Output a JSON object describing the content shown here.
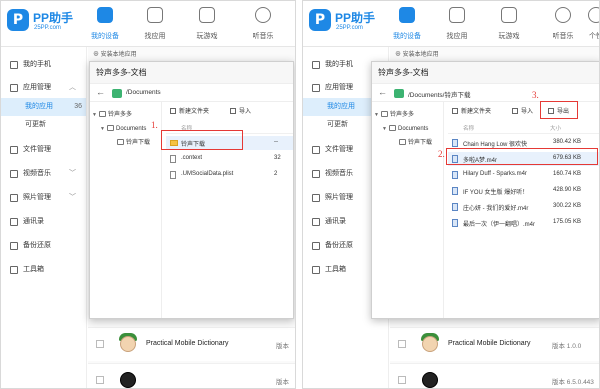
{
  "header": {
    "logo_letter": "P",
    "brand": "PP助手",
    "brand_url": "25PP.com",
    "nav": [
      {
        "label": "我的设备",
        "icon": "phone-icon",
        "active": true
      },
      {
        "label": "找应用",
        "icon": "bag-icon",
        "active": false
      },
      {
        "label": "玩游戏",
        "icon": "gamepad-icon",
        "active": false
      },
      {
        "label": "听音乐",
        "icon": "headphones-icon",
        "active": false
      }
    ],
    "nav_right_partial": "个性",
    "toolbar_partial": "安装本地应用"
  },
  "sidebar": {
    "items": [
      {
        "label": "我的手机",
        "icon": "phone-icon"
      },
      {
        "label": "应用管理",
        "icon": "apps-icon",
        "expanded": true
      },
      {
        "label": "文件管理",
        "icon": "folder-icon"
      },
      {
        "label": "视频音乐",
        "icon": "video-icon"
      },
      {
        "label": "照片管理",
        "icon": "photo-icon"
      },
      {
        "label": "通讯录",
        "icon": "contacts-icon"
      },
      {
        "label": "备份还原",
        "icon": "backup-icon"
      },
      {
        "label": "工具箱",
        "icon": "toolbox-icon"
      }
    ],
    "sub_items": [
      {
        "label": "我的应用",
        "count": "36",
        "selected": true
      },
      {
        "label": "可更新",
        "count": ""
      }
    ]
  },
  "background_apps": [
    {
      "name": "Practical Mobile Dictionary",
      "version_left": "版本",
      "version_right": "版本 1.0.0"
    },
    {
      "name": "",
      "version_left": "版本",
      "version_right": "版本 6.5.0.443"
    }
  ],
  "dialog_left": {
    "title": "铃声多多-文档",
    "path": "/Documents",
    "tree": [
      {
        "label": "铃声多多",
        "level": 0
      },
      {
        "label": "Documents",
        "level": 1
      },
      {
        "label": "铃声下载",
        "level": 2
      }
    ],
    "actions": {
      "new_folder": "新建文件夹",
      "import": "导入"
    },
    "column_name": "名称",
    "files": [
      {
        "name": "铃声下载",
        "size": "--",
        "type": "folder"
      },
      {
        "name": ".context",
        "size": "32",
        "type": "file"
      },
      {
        "name": ".UMSocialData.plist",
        "size": "2",
        "type": "file"
      }
    ],
    "step_label": "1."
  },
  "dialog_right": {
    "title": "铃声多多-文档",
    "path": "/Documents/铃声下载",
    "tree": [
      {
        "label": "铃声多多",
        "level": 0
      },
      {
        "label": "Documents",
        "level": 1
      },
      {
        "label": "铃声下载",
        "level": 2
      }
    ],
    "actions": {
      "new_folder": "新建文件夹",
      "import": "导入",
      "export": "导出"
    },
    "column_name": "名称",
    "column_size": "大小",
    "files": [
      {
        "name": "Chain Hang Low  很欢快",
        "size": "380.42 KB"
      },
      {
        "name": "多啦A梦.m4r",
        "size": "679.63 KB"
      },
      {
        "name": "Hilary Duff - Sparks.m4r",
        "size": "160.74 KB"
      },
      {
        "name": "IF YOU 女生版  爆好听！",
        "size": "428.90 KB"
      },
      {
        "name": "庄心妍 - 我们的爱好.m4r",
        "size": "300.22 KB"
      },
      {
        "name": "最后一次（伊一翻唱）.m4r",
        "size": "175.05 KB"
      }
    ],
    "step2_label": "2.",
    "step3_label": "3."
  },
  "colors": {
    "accent": "#1e88e5",
    "highlight": "#e53935",
    "selected_bg": "#ddeefc"
  }
}
